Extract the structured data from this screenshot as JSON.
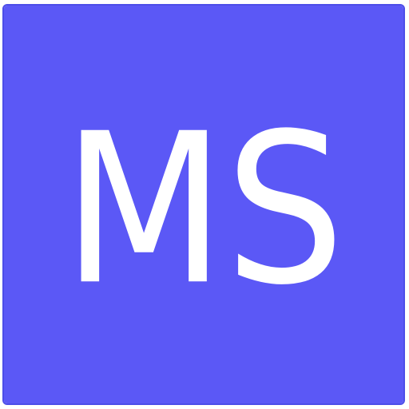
{
  "app_icon": {
    "logo_text": "MS",
    "icon_name": "ms-monogram-icon",
    "colors": {
      "background": "#5b58f6",
      "border": "#4d4ee8",
      "glyph": "#ffffff"
    }
  }
}
